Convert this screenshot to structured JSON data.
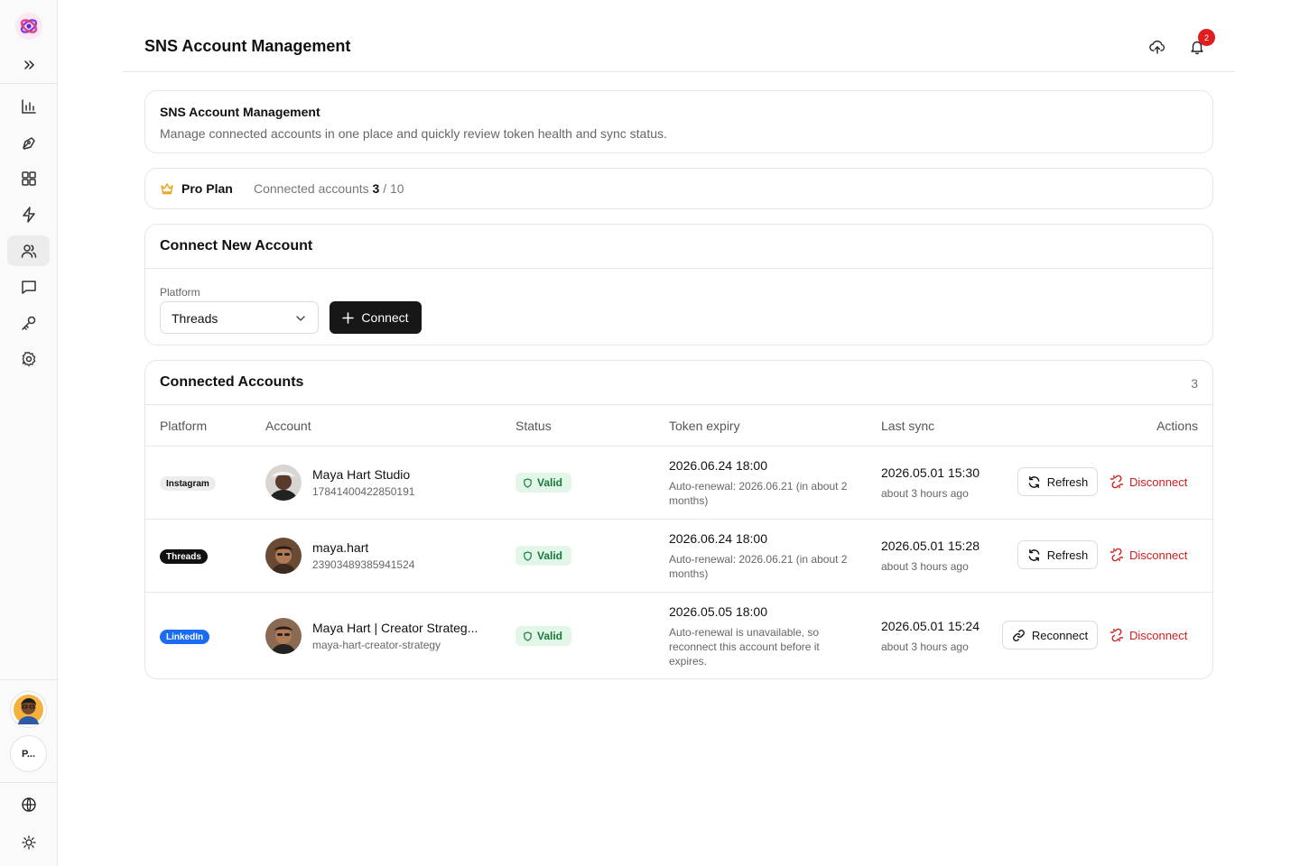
{
  "header": {
    "title": "SNS Account Management",
    "notifications_count": "2"
  },
  "sidebar": {
    "workspace_label": "P...",
    "nav": [
      {
        "icon": "chart-icon"
      },
      {
        "icon": "pen-tool-icon"
      },
      {
        "icon": "grid-icon"
      },
      {
        "icon": "lightning-icon"
      },
      {
        "icon": "users-icon",
        "active": true
      },
      {
        "icon": "message-icon"
      },
      {
        "icon": "key-icon"
      },
      {
        "icon": "gear-icon"
      }
    ]
  },
  "intro": {
    "title": "SNS Account Management",
    "description": "Manage connected accounts in one place and quickly review token health and sync status."
  },
  "plan": {
    "name": "Pro Plan",
    "connected_label": "Connected accounts",
    "connected": "3",
    "limit": "/ 10"
  },
  "connect": {
    "title": "Connect New Account",
    "platform_label": "Platform",
    "platform_value": "Threads",
    "button": "Connect"
  },
  "accounts": {
    "title": "Connected Accounts",
    "count": "3",
    "headers": {
      "platform": "Platform",
      "account": "Account",
      "status": "Status",
      "expiry": "Token expiry",
      "sync": "Last sync",
      "actions": "Actions"
    },
    "rows": [
      {
        "platform": "Instagram",
        "name": "Maya Hart Studio",
        "id": "17841400422850191",
        "status": "Valid",
        "expiry": "2026.06.24 18:00",
        "expiry_note": "Auto-renewal: 2026.06.21 (in about 2 months)",
        "sync": "2026.05.01 15:30",
        "sync_ago": "about 3 hours ago",
        "action": "Refresh",
        "disconnect": "Disconnect"
      },
      {
        "platform": "Threads",
        "name": "maya.hart",
        "id": "23903489385941524",
        "status": "Valid",
        "expiry": "2026.06.24 18:00",
        "expiry_note": "Auto-renewal: 2026.06.21 (in about 2 months)",
        "sync": "2026.05.01 15:28",
        "sync_ago": "about 3 hours ago",
        "action": "Refresh",
        "disconnect": "Disconnect"
      },
      {
        "platform": "LinkedIn",
        "name": "Maya Hart | Creator Strateg...",
        "id": "maya-hart-creator-strategy",
        "status": "Valid",
        "expiry": "2026.05.05 18:00",
        "expiry_note": "Auto-renewal is unavailable, so reconnect this account before it expires.",
        "sync": "2026.05.01 15:24",
        "sync_ago": "about 3 hours ago",
        "action": "Reconnect",
        "disconnect": "Disconnect"
      }
    ]
  },
  "colors": {
    "accent": "#171717",
    "valid_bg": "#e2f7e8",
    "valid_fg": "#167a3a",
    "danger": "#d11d1d",
    "linkedin": "#1a6cf2",
    "badge": "#e01e1e"
  }
}
